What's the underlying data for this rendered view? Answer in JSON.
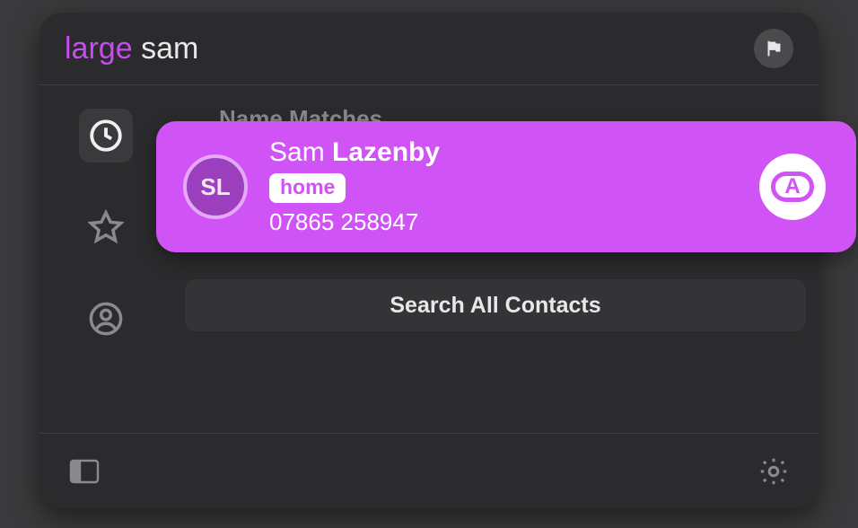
{
  "search": {
    "prefix": "large",
    "query": "sam"
  },
  "section_label": "Name Matches",
  "match": {
    "initials": "SL",
    "first_name": "Sam",
    "last_name": "Lazenby",
    "tag": "home",
    "phone": "07865 258947",
    "action_letter": "A"
  },
  "search_all_label": "Search All Contacts",
  "sidebar": {
    "recent_active": true
  },
  "colors": {
    "accent": "#cf53f5",
    "prefix": "#c84cf0"
  }
}
